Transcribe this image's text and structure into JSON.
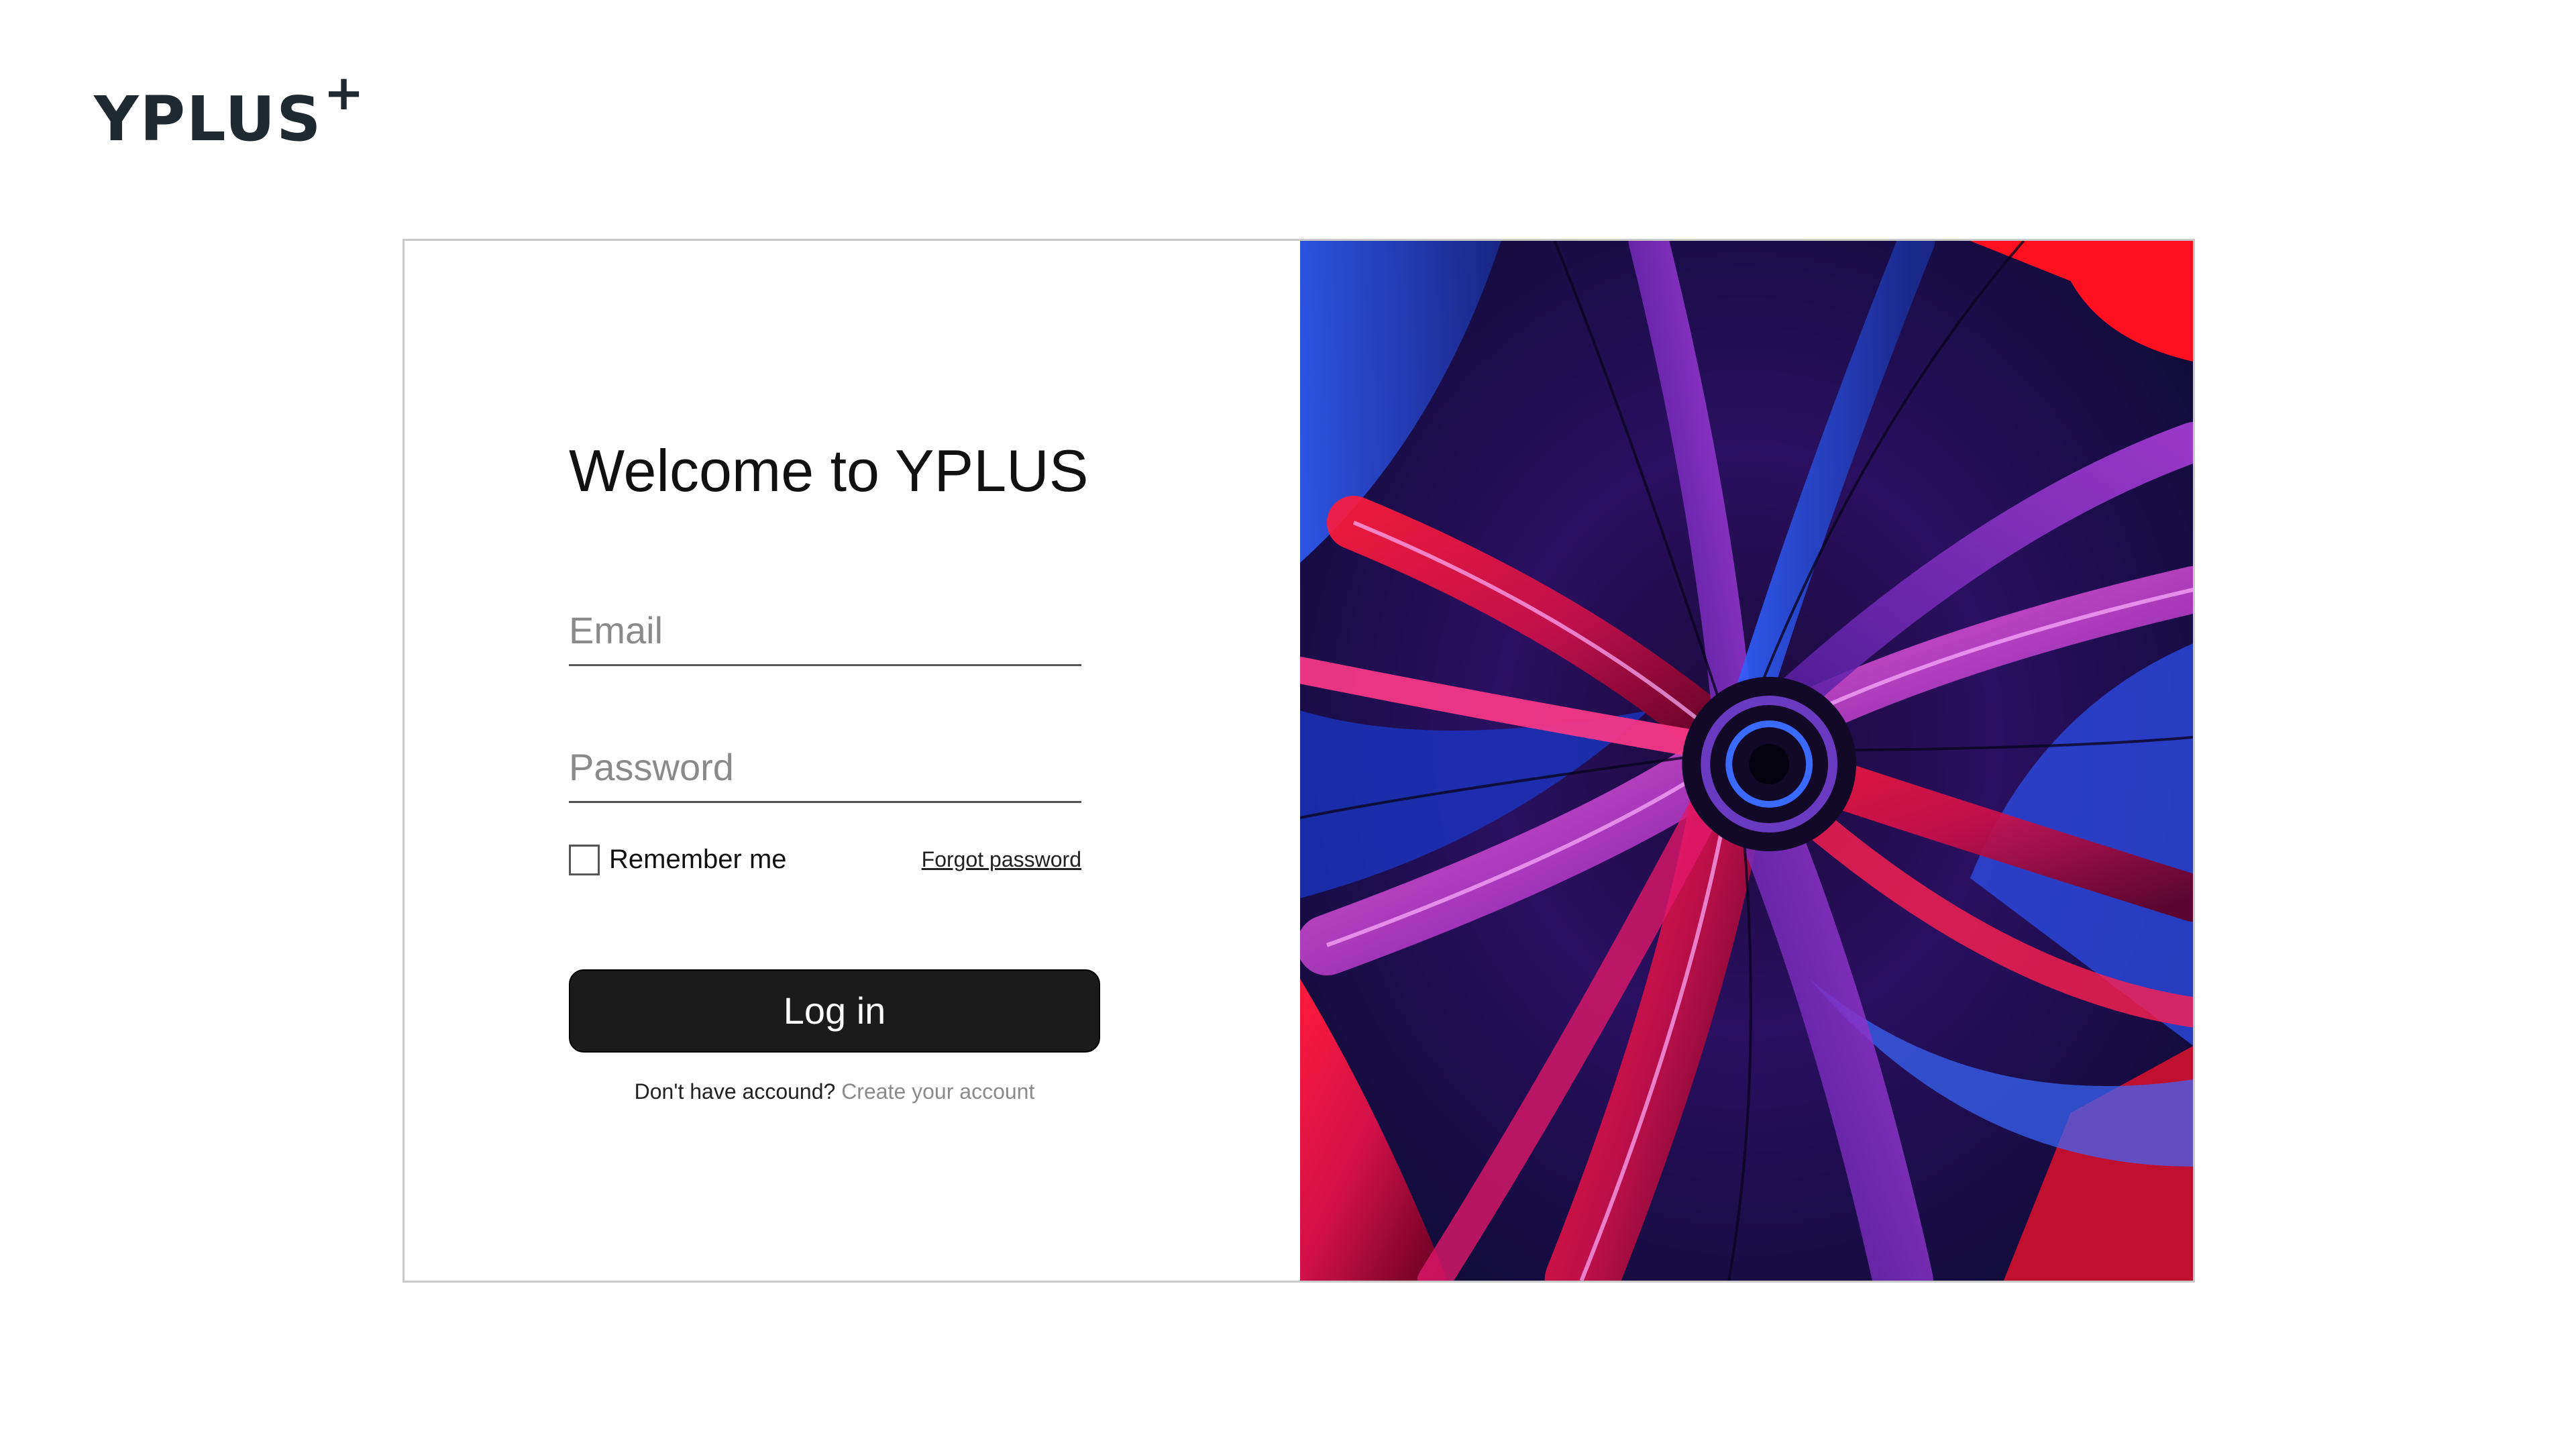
{
  "brand": {
    "logo_text": "YPLUS",
    "logo_superscript": "+"
  },
  "login": {
    "title": "Welcome to YPLUS",
    "email_placeholder": "Email",
    "email_value": "",
    "password_placeholder": "Password",
    "password_value": "",
    "remember_label": "Remember me",
    "remember_checked": false,
    "forgot_label": "Forgot password",
    "submit_label": "Log in",
    "signup_prompt": "Don't have accound?",
    "signup_link": "Create your account"
  },
  "colors": {
    "button_bg": "#1b1b1b",
    "logo": "#1f2a30",
    "link_muted": "#8a8a8a",
    "art_red": "#e0102a",
    "art_blue": "#2e5cff",
    "art_purple": "#8a2be2",
    "art_dark": "#0a0a30"
  },
  "art": {
    "description_icon": "abstract-3d-art-image"
  }
}
